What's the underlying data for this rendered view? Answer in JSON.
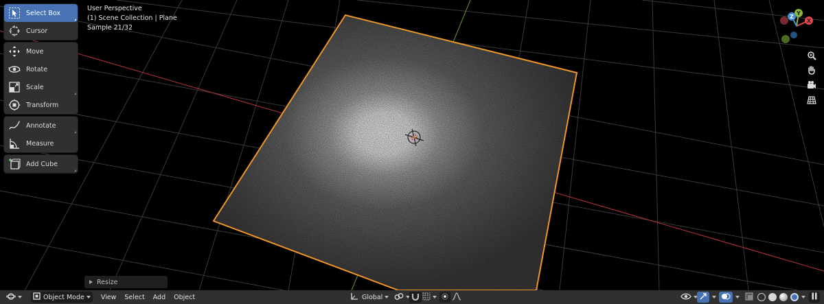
{
  "viewport": {
    "info_lines": [
      "User Perspective",
      "(1) Scene Collection | Plane",
      "Sample 21/32"
    ]
  },
  "toolbar": {
    "groups": [
      [
        {
          "label": "Select Box",
          "icon": "select-box-icon",
          "active": true
        },
        {
          "label": "Cursor",
          "icon": "cursor-icon"
        }
      ],
      [
        {
          "label": "Move",
          "icon": "move-icon"
        },
        {
          "label": "Rotate",
          "icon": "rotate-icon"
        },
        {
          "label": "Scale",
          "icon": "scale-icon"
        },
        {
          "label": "Transform",
          "icon": "transform-icon"
        }
      ],
      [
        {
          "label": "Annotate",
          "icon": "annotate-icon"
        },
        {
          "label": "Measure",
          "icon": "measure-icon"
        }
      ],
      [
        {
          "label": "Add Cube",
          "icon": "add-cube-icon"
        }
      ]
    ]
  },
  "gizmo": {
    "axes": [
      "Z",
      "Y",
      "X"
    ],
    "colors": {
      "x": "#e2474f",
      "y": "#8bb83d",
      "z": "#3f8ddb"
    },
    "nav_buttons": [
      "zoom-icon",
      "hand-pan-icon",
      "camera-icon",
      "grid-ortho-icon"
    ]
  },
  "last_operator": {
    "label": "Resize"
  },
  "header": {
    "mode": "Object Mode",
    "menus": [
      "View",
      "Select",
      "Add",
      "Object"
    ],
    "transform_orientation": "Global"
  },
  "colors": {
    "accent": "#4772b3",
    "selection_outline": "#f0962c",
    "axis_x": "#b5323b",
    "axis_y": "#6a9a2a",
    "grid": "#3b3b3b"
  }
}
